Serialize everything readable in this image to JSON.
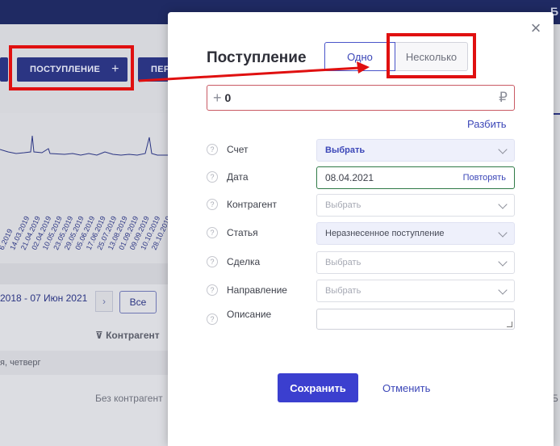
{
  "background": {
    "toolbar": {
      "income_button_label": "ПОСТУПЛЕНИЕ",
      "income_plus": "+",
      "transfer_button_label": "ПЕР"
    },
    "chart_date_labels": [
      "6.2019",
      "14.03.2019",
      "21.04.2019",
      "02.04.2019",
      "10.05.2019",
      "23.05.2019",
      "29.05.2019",
      "05.06.2019",
      "17.06.2019",
      "25.07.2019",
      "13.08.2019",
      "01.09.2019",
      "09.09.2019",
      "10.10.2019",
      "28.10.2019"
    ],
    "period_label": "2018 - 07 Июн 2021",
    "period_next": "›",
    "all_button_label": "Все",
    "counterparty_column": "Контрагент",
    "day_label": "я, четверг",
    "no_counterparty": "Без контрагент",
    "right_edge_text": "Б"
  },
  "modal": {
    "title": "Поступление",
    "close_glyph": "×",
    "mode_tabs": [
      {
        "label": "Одно",
        "active": true
      },
      {
        "label": "Несколько",
        "active": false
      }
    ],
    "amount": {
      "plus": "+",
      "value": "0",
      "currency": "₽"
    },
    "split_link": "Разбить",
    "help_glyph": "?",
    "fields": [
      {
        "label": "Счет",
        "value": "Выбрать",
        "style": "strong"
      },
      {
        "label": "Дата",
        "value": "08.04.2021",
        "action": "Повторять",
        "style": "date"
      },
      {
        "label": "Контрагент",
        "value": "Выбрать",
        "style": "placeholder"
      },
      {
        "label": "Статья",
        "value": "Неразнесенное поступление",
        "style": "filled"
      },
      {
        "label": "Сделка",
        "value": "Выбрать",
        "style": "placeholder"
      },
      {
        "label": "Направление",
        "value": "Выбрать",
        "style": "placeholder"
      },
      {
        "label": "Описание",
        "value": "",
        "style": "textarea"
      }
    ],
    "save_label": "Сохранить",
    "cancel_label": "Отменить"
  },
  "colors": {
    "annotation_red": "#e01010",
    "primary_blue": "#3b3fcf",
    "link_blue": "#3c47b8",
    "date_border_green": "#2f7a46"
  }
}
